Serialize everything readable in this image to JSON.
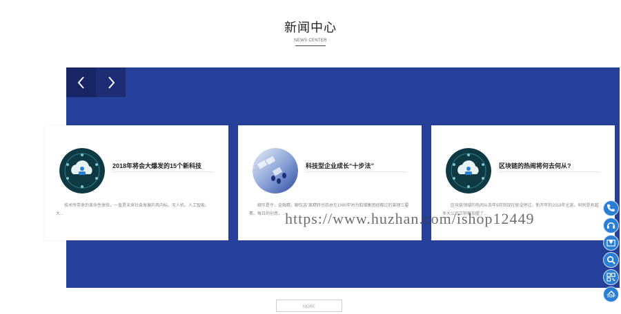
{
  "section": {
    "title": "新闻中心",
    "subtitle": "NEWS CENTER"
  },
  "cards": [
    {
      "title": "2018年将会大爆发的15个新科技",
      "excerpt": "技术所带来的革命性体验，一直是未来社会发展的风向标。无人机、人工智能、大...",
      "image": "cloud-network-icon"
    },
    {
      "title": "科技型企业成长“十步法”",
      "excerpt": "细节是乎，金融精，聊仅选”离精转也岗总在1990年时为取增集团经都过的曾理三要素。每日的创意，...",
      "image": "keyboard-photo"
    },
    {
      "title": "区块链的热闹将何去何从?",
      "excerpt": "区块链领域的热闹从去年9月到现在就没停过。新开年的2018年尤甚。科别是有越多大公司正积极加盟了...",
      "image": "cloud-network-icon"
    }
  ],
  "more_label": "MORE",
  "watermark": "https://www.huzhan.com/ishop12449",
  "sidebar": {
    "top_label": "TOP",
    "icons": [
      "phone-icon",
      "headset-icon",
      "location-icon",
      "search-icon",
      "qrcode-icon",
      "back-to-top-icon"
    ]
  },
  "colors": {
    "panel_blue": "#27409a",
    "nav_dark": "#172564",
    "side_blue": "#2a7fd4"
  }
}
